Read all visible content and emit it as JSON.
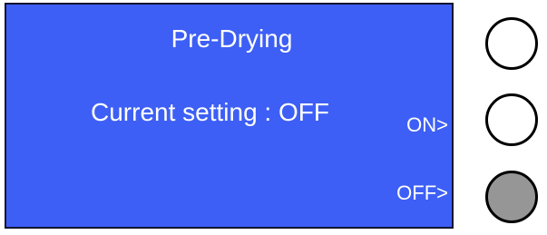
{
  "screen": {
    "title": "Pre-Drying",
    "current_setting": "Current setting : OFF",
    "on_label": "ON>",
    "off_label": "OFF>",
    "background_color": "#3d5ff5",
    "text_color": "#ffffff"
  },
  "buttons": [
    {
      "id": "top",
      "fill": "#ffffff",
      "active": false
    },
    {
      "id": "middle",
      "fill": "#ffffff",
      "active": false
    },
    {
      "id": "bottom",
      "fill": "#969696",
      "active": true
    }
  ]
}
